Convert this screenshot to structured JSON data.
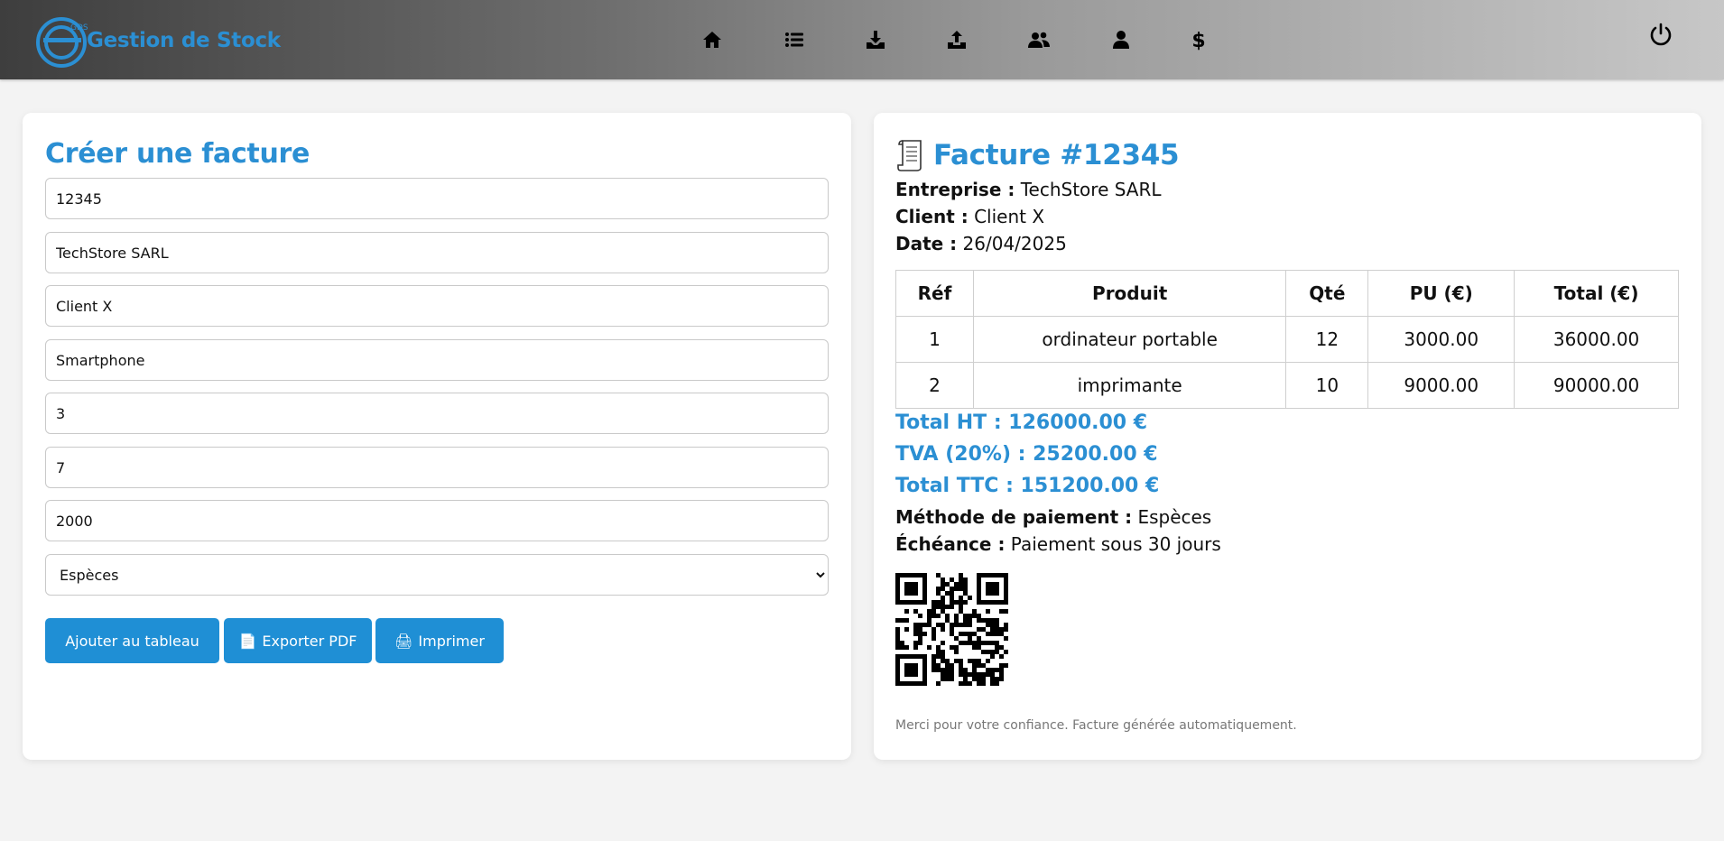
{
  "header": {
    "logo_mark": "GDS",
    "brand_title": "Gestion de Stock",
    "nav": [
      {
        "icon": "home-icon"
      },
      {
        "icon": "list-icon"
      },
      {
        "icon": "download-icon"
      },
      {
        "icon": "upload-icon"
      },
      {
        "icon": "users-icon"
      },
      {
        "icon": "user-icon"
      },
      {
        "icon": "dollar-icon"
      }
    ],
    "power_icon": "power-icon"
  },
  "form": {
    "title": "Créer une facture",
    "invoice_number": "12345",
    "company": "TechStore SARL",
    "client": "Client X",
    "product": "Smartphone",
    "quantity": "3",
    "field6": "7",
    "unit_price": "2000",
    "payment_method": "Espèces",
    "payment_options": [
      "Espèces"
    ],
    "buttons": {
      "add": "Ajouter au tableau",
      "export": "Exporter PDF",
      "print": "Imprimer"
    }
  },
  "invoice": {
    "title": "Facture #12345",
    "company_label": "Entreprise :",
    "company": "TechStore SARL",
    "client_label": "Client :",
    "client": "Client X",
    "date_label": "Date :",
    "date": "26/04/2025",
    "table": {
      "headers": [
        "Réf",
        "Produit",
        "Qté",
        "PU (€)",
        "Total (€)"
      ],
      "rows": [
        [
          "1",
          "ordinateur portable",
          "12",
          "3000.00",
          "36000.00"
        ],
        [
          "2",
          "imprimante",
          "10",
          "9000.00",
          "90000.00"
        ]
      ]
    },
    "total_ht": "Total HT : 126000.00 €",
    "tva": "TVA (20%) : 25200.00 €",
    "total_ttc": "Total TTC : 151200.00 €",
    "payment_label": "Méthode de paiement :",
    "payment": "Espèces",
    "due_label": "Échéance :",
    "due": "Paiement sous 30 jours",
    "thanks": "Merci pour votre confiance. Facture générée automatiquement."
  },
  "colors": {
    "accent": "#2b8fd3",
    "button": "#1f8fd5"
  }
}
